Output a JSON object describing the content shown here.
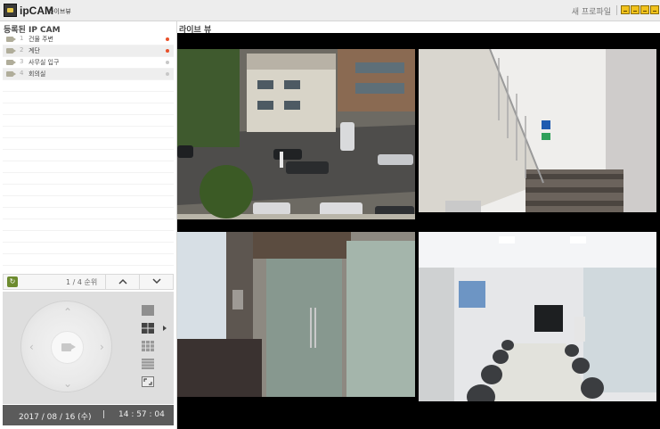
{
  "titlebar": {
    "app_name": "ipCAM",
    "app_subtitle": "라이브뷰",
    "profile_button": "새 프로파일"
  },
  "left_panel": {
    "title": "등록된 IP CAM",
    "cameras": [
      {
        "num": "1",
        "name": "건물 주변",
        "status_color": "#e8502a"
      },
      {
        "num": "2",
        "name": "계단",
        "status_color": "#e8502a"
      },
      {
        "num": "3",
        "name": "사무실 입구",
        "status_color": "#c8c8c8"
      },
      {
        "num": "4",
        "name": "회의실",
        "status_color": "#c8c8c8"
      }
    ],
    "pager_text": "1 / 4 순위"
  },
  "status_bar": {
    "date": "2017 / 08 / 16 (수)",
    "separator": "|",
    "time": "14 : 57 : 04"
  },
  "live_view": {
    "title": "라이브 뷰",
    "active_layout": "4-split"
  },
  "colors": {
    "accent": "#6d8b2f",
    "window_buttons": "#f1c21b",
    "status_bar": "#5b5b5b"
  }
}
